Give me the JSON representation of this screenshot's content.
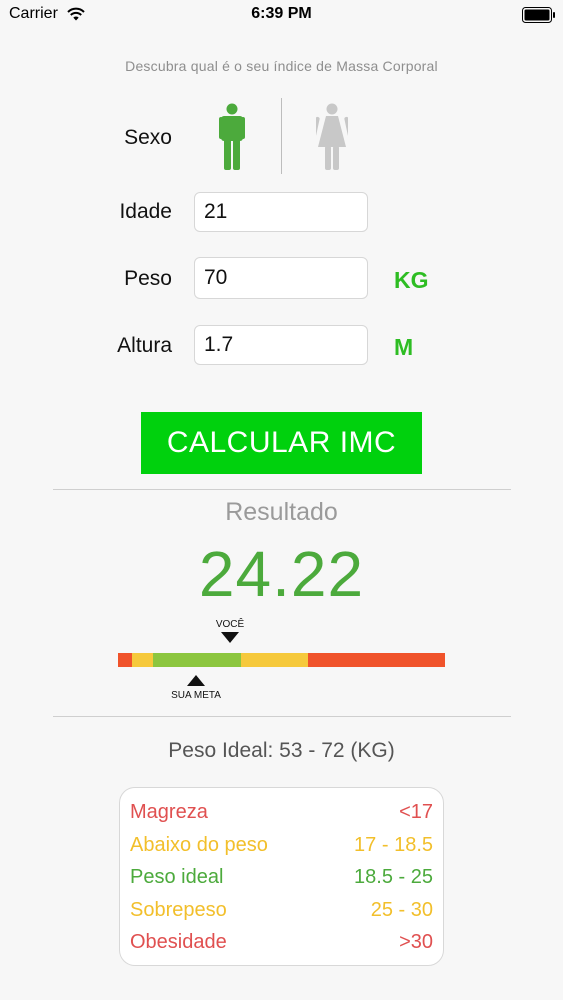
{
  "status_bar": {
    "carrier": "Carrier",
    "time": "6:39 PM"
  },
  "header": {
    "subtitle": "Descubra qual é o seu índice de Massa Corporal"
  },
  "form": {
    "sexo_label": "Sexo",
    "selected_sex": "male",
    "idade_label": "Idade",
    "idade_value": "21",
    "peso_label": "Peso",
    "peso_value": "70",
    "peso_unit": "KG",
    "altura_label": "Altura",
    "altura_value": "1.7",
    "altura_unit": "M"
  },
  "calculate_button": "CALCULAR IMC",
  "result": {
    "label": "Resultado",
    "value": "24.22",
    "you_label": "VOCÊ",
    "goal_label": "SUA META",
    "ideal_weight": "Peso Ideal: 53 - 72 (KG)"
  },
  "bmi_scale": {
    "segments_colors": [
      "#f0532b",
      "#f6c93c",
      "#8cc63f",
      "#f6c93c",
      "#f0532b"
    ]
  },
  "legend": [
    {
      "name": "Magreza",
      "range": "<17",
      "color": "#e05050"
    },
    {
      "name": "Abaixo do peso",
      "range": "17 - 18.5",
      "color": "#f2bf2b"
    },
    {
      "name": "Peso ideal",
      "range": "18.5 - 25",
      "color": "#4caa3c"
    },
    {
      "name": "Sobrepeso",
      "range": "25 - 30",
      "color": "#f2bf2b"
    },
    {
      "name": "Obesidade",
      "range": ">30",
      "color": "#e05050"
    }
  ],
  "colors": {
    "accent_green": "#00d10d",
    "unit_green": "#2ebd23",
    "result_green": "#4caa3c",
    "inactive_icon": "#c8c8c8"
  }
}
